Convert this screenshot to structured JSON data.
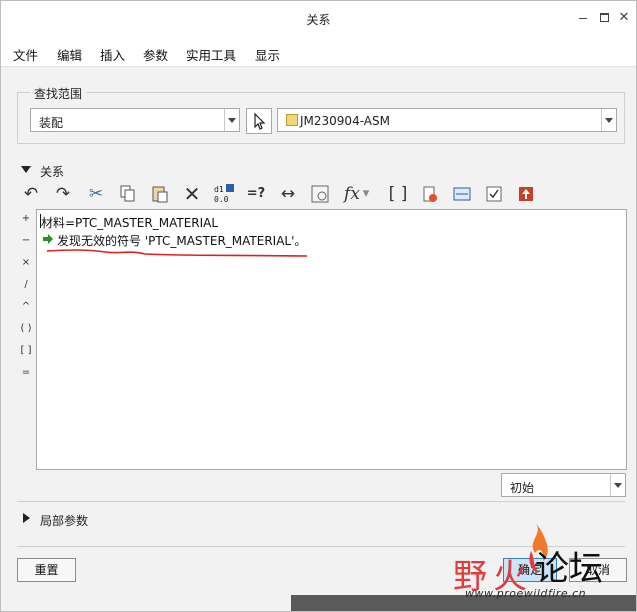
{
  "window": {
    "title": "关系"
  },
  "menu": [
    "文件",
    "编辑",
    "插入",
    "参数",
    "实用工具",
    "显示"
  ],
  "find_scope": {
    "legend": "查找范围",
    "scope_value": "装配",
    "model_value": "JM230904-ASM"
  },
  "relations": {
    "label": "关系",
    "operators": [
      "+",
      "−",
      "×",
      "/",
      "^",
      "( )",
      "[ ]",
      "="
    ],
    "editor_lines": [
      "材料=PTC_MASTER_MATERIAL",
      "发现无效的符号 'PTC_MASTER_MATERIAL'。"
    ],
    "status_value": "初始"
  },
  "toolbar_icons": [
    "undo-icon",
    "redo-icon",
    "cut-icon",
    "copy-icon",
    "paste-icon",
    "delete-icon",
    "sort-icon",
    "evaluate-icon",
    "measure-icon",
    "display-icon",
    "function-icon",
    "parameter-icon",
    "verify-icon",
    "units-icon",
    "check-icon",
    "sort-up-icon"
  ],
  "local_params": {
    "label": "局部参数"
  },
  "buttons": {
    "reset": "重置",
    "ok": "确定",
    "cancel": "取消"
  },
  "watermark": {
    "part1": "野",
    "part2": "火",
    "part3": "论坛",
    "url": "www.proewildfire.cn"
  },
  "colors": {
    "accent_red": "#e02020",
    "ok_blue": "#cce4f7",
    "arrow_green": "#2e8b2e"
  }
}
